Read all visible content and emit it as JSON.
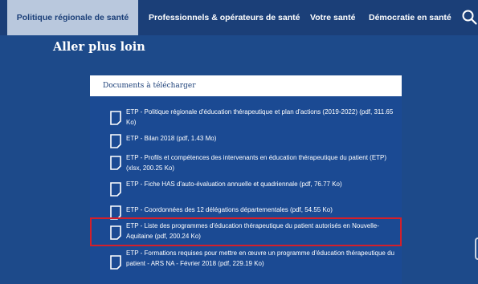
{
  "nav": {
    "items": [
      {
        "label": "Politique régionale de santé",
        "active": true
      },
      {
        "label": "Professionnels & opérateurs de santé",
        "active": false
      },
      {
        "label": "Votre santé",
        "active": false
      },
      {
        "label": "Démocratie en santé",
        "active": false
      }
    ],
    "search_icon": "search-icon"
  },
  "page": {
    "heading": "Aller plus loin"
  },
  "documents": {
    "header": "Documents à télécharger",
    "items": [
      {
        "text": "ETP - Politique régionale d'éducation thérapeutique et plan d'actions (2019-2022) (pdf, 311.65 Ko)",
        "highlighted": false
      },
      {
        "text": "ETP - Bilan 2018 (pdf, 1.43 Mo)",
        "highlighted": false
      },
      {
        "text": "ETP - Profils et compétences des intervenants en éducation thérapeutique du patient (ETP) (xlsx, 200.25 Ko)",
        "highlighted": false
      },
      {
        "text": "ETP - Fiche HAS d'auto-évaluation annuelle et quadriennale (pdf, 76.77 Ko)",
        "highlighted": false
      },
      {
        "text": "ETP - Coordonnées des 12 délégations départementales (pdf, 54.55 Ko)",
        "highlighted": false
      },
      {
        "text": "ETP - Liste des programmes d'éducation thérapeutique du patient autorisés en Nouvelle-Aquitaine (pdf, 200.24 Ko)",
        "highlighted": true
      },
      {
        "text": "ETP - Formations requises pour mettre en œuvre un programme d'éducation thérapeutique du patient - ARS NA - Février 2018 (pdf, 229.19 Ko)",
        "highlighted": false
      }
    ],
    "item_icon": "document-icon"
  },
  "colors": {
    "background": "#1d4a8a",
    "nav_background": "#1b3f78",
    "active_tab": "#b9c8dd",
    "highlight_border": "#d41f2a"
  }
}
